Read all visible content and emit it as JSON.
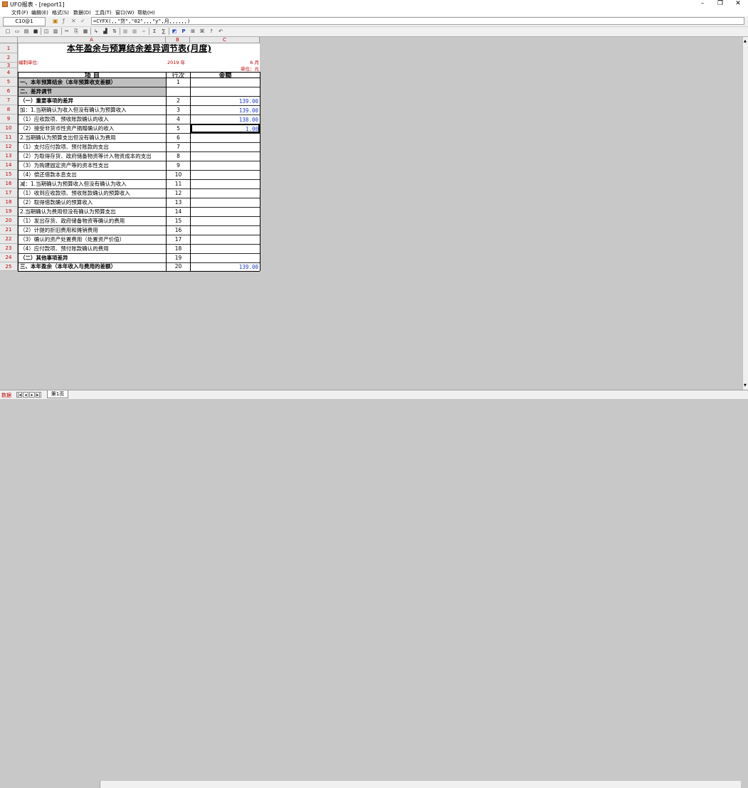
{
  "window": {
    "title": "UFO报表 - [report1]",
    "minimize": "–",
    "maximize": "❐",
    "close": "✕"
  },
  "menu": [
    "文件(F)",
    "编辑(E)",
    "格式(S)",
    "数据(D)",
    "工具(T)",
    "窗口(W)",
    "帮助(H)"
  ],
  "formula_bar": {
    "cell_ref": "C10@1",
    "formula": "=CYFX(,,\"贷\",\"02\",,,\"y\",月,,,,,,)"
  },
  "sheet": {
    "columns": [
      "A",
      "B",
      "C"
    ],
    "title": "本年盈余与预算结余差异调节表(月度)",
    "org_label": "编制单位:",
    "year": "2019 年",
    "month": "6 月",
    "unit": "单位：元",
    "header_item": "项  目",
    "header_row": "行次",
    "header_amount": "金额",
    "rows": [
      {
        "num": "1",
        "item": "",
        "line": "",
        "amount": ""
      },
      {
        "num": "2",
        "item": "",
        "line": "",
        "amount": ""
      },
      {
        "num": "3",
        "item": "",
        "line": "",
        "amount": ""
      },
      {
        "num": "4",
        "item": "",
        "line": "",
        "amount": ""
      },
      {
        "num": "5",
        "item": "一、本年预算结余（本年预算收支差额）",
        "line": "1",
        "amount": ""
      },
      {
        "num": "6",
        "item": "二、差异调节",
        "line": "",
        "amount": ""
      },
      {
        "num": "7",
        "item": "（一）重要事项的差异",
        "line": "2",
        "amount": "139.00"
      },
      {
        "num": "8",
        "item": "加：1.当期确认为收入但没有确认为预算收入",
        "line": "3",
        "amount": "139.00"
      },
      {
        "num": "9",
        "item": "（1）应收款项、预收账款确认的收入",
        "line": "4",
        "amount": "138.00"
      },
      {
        "num": "10",
        "item": "（2）接受非货币性资产捐赠确认的收入",
        "line": "5",
        "amount": "1.00"
      },
      {
        "num": "11",
        "item": "2.当期确认为预算支出但没有确认为费用",
        "line": "6",
        "amount": ""
      },
      {
        "num": "12",
        "item": "（1）支付应付款项、预付账款的支出",
        "line": "7",
        "amount": ""
      },
      {
        "num": "13",
        "item": "（2）为取得存货、政府储备物资等计入物资成本的支出",
        "line": "8",
        "amount": ""
      },
      {
        "num": "14",
        "item": "（3）为购建固定资产等的资本性支出",
        "line": "9",
        "amount": ""
      },
      {
        "num": "15",
        "item": "（4）偿还借款本息支出",
        "line": "10",
        "amount": ""
      },
      {
        "num": "16",
        "item": "减：1.当期确认为预算收入但没有确认为收入",
        "line": "11",
        "amount": ""
      },
      {
        "num": "17",
        "item": "（1）收到应收款项、预收账款确认的预算收入",
        "line": "12",
        "amount": ""
      },
      {
        "num": "18",
        "item": "（2）取得借款确认的预算收入",
        "line": "13",
        "amount": ""
      },
      {
        "num": "19",
        "item": "2.当期确认为费用但没有确认为预算支出",
        "line": "14",
        "amount": ""
      },
      {
        "num": "20",
        "item": "（1）发出存货、政府储备物资等确认的费用",
        "line": "15",
        "amount": ""
      },
      {
        "num": "21",
        "item": "（2）计提的折旧费用和摊销费用",
        "line": "16",
        "amount": ""
      },
      {
        "num": "22",
        "item": "（3）确认的资产处置费用（处置资产价值）",
        "line": "17",
        "amount": ""
      },
      {
        "num": "23",
        "item": "（4）应付款项、预付账款确认的费用",
        "line": "18",
        "amount": ""
      },
      {
        "num": "24",
        "item": "（二）其他事项差异",
        "line": "19",
        "amount": ""
      },
      {
        "num": "25",
        "item": "三、本年盈余（本年收入与费用的差额）",
        "line": "20",
        "amount": "139.00"
      }
    ]
  },
  "status": {
    "mode": "数据",
    "sheet_tab": "第1页"
  },
  "colors": {
    "header_red": "#c00000",
    "value_blue": "#1a3cc7",
    "section_gray": "#c0c0c0"
  }
}
